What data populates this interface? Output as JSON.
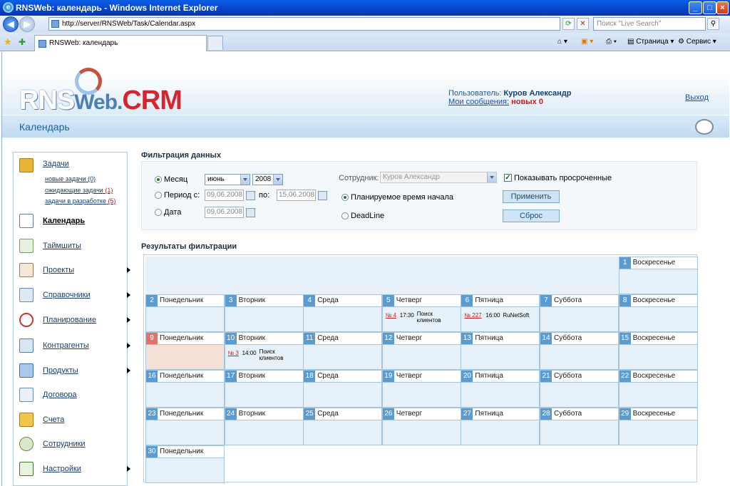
{
  "window": {
    "title": "RNSWeb: календарь - Windows Internet Explorer"
  },
  "browser": {
    "url": "http://server/RNSWeb/Task/Calendar.aspx",
    "search_placeholder": "Поиск \"Live Search\"",
    "tab_title": "RNSWeb: календарь",
    "toolbar": {
      "page": "Страница",
      "tools": "Сервис"
    }
  },
  "header": {
    "logo": {
      "rns": "RNS",
      "web": "Web.",
      "crm": "CRM"
    },
    "user_label": "Пользователь:",
    "user_name": "Куров Александр",
    "messages_link": "Мои сообщения:",
    "messages_new": "новых",
    "messages_count": "0",
    "logout": "Выход",
    "page_title": "Календарь"
  },
  "sidebar": {
    "tasks": {
      "label": "Задачи",
      "sub": [
        {
          "label": "новые задачи",
          "count": "(0)"
        },
        {
          "label": "ожидающие задачи",
          "count": "(1)"
        },
        {
          "label": "задачи в разработке",
          "count": "(5)"
        }
      ]
    },
    "items": [
      {
        "label": "Календарь"
      },
      {
        "label": "Таймшиты"
      },
      {
        "label": "Проекты"
      },
      {
        "label": "Справочники"
      },
      {
        "label": "Планирование"
      },
      {
        "label": "Контрагенты"
      },
      {
        "label": "Продукты"
      },
      {
        "label": "Договора"
      },
      {
        "label": "Счета"
      },
      {
        "label": "Сотрудники"
      },
      {
        "label": "Настройки"
      }
    ]
  },
  "filter": {
    "title": "Фильтрация данных",
    "month_label": "Месяц",
    "month_value": "июнь",
    "year_value": "2008",
    "period_label": "Период с:",
    "period_from": "09.06.2008",
    "period_to_label": "по:",
    "period_to": "15.06.2008",
    "date_label": "Дата",
    "date_value": "09.06.2008",
    "employee_label": "Сотрудник:",
    "employee_value": "Куров Александр",
    "show_overdue": "Показывать просроченные",
    "planned_start": "Планируемое время начала",
    "deadline": "DeadLine",
    "apply": "Применить",
    "reset": "Сброс"
  },
  "results": {
    "title": "Результаты фильтрации"
  },
  "calendar": {
    "days": [
      {
        "num": "1",
        "name": "Воскресенье"
      },
      {
        "num": "2",
        "name": "Понедельник"
      },
      {
        "num": "3",
        "name": "Вторник"
      },
      {
        "num": "4",
        "name": "Среда"
      },
      {
        "num": "5",
        "name": "Четверг",
        "event": {
          "ref": "№ 4",
          "time": "17:30",
          "desc": "Поиск клиентов"
        }
      },
      {
        "num": "6",
        "name": "Пятница",
        "event": {
          "ref": "№ 227",
          "time": "16:00",
          "desc": "RuNetSoft"
        }
      },
      {
        "num": "7",
        "name": "Суббота"
      },
      {
        "num": "8",
        "name": "Воскресенье"
      },
      {
        "num": "9",
        "name": "Понедельник",
        "today": true
      },
      {
        "num": "10",
        "name": "Вторник",
        "event": {
          "ref": "№ 3",
          "time": "14:00",
          "desc": "Поиск клиентов"
        }
      },
      {
        "num": "11",
        "name": "Среда"
      },
      {
        "num": "12",
        "name": "Четверг"
      },
      {
        "num": "13",
        "name": "Пятница"
      },
      {
        "num": "14",
        "name": "Суббота"
      },
      {
        "num": "15",
        "name": "Воскресенье"
      },
      {
        "num": "16",
        "name": "Понедельник"
      },
      {
        "num": "17",
        "name": "Вторник"
      },
      {
        "num": "18",
        "name": "Среда"
      },
      {
        "num": "19",
        "name": "Четверг"
      },
      {
        "num": "20",
        "name": "Пятница"
      },
      {
        "num": "21",
        "name": "Суббота"
      },
      {
        "num": "22",
        "name": "Воскресенье"
      },
      {
        "num": "23",
        "name": "Понедельник"
      },
      {
        "num": "24",
        "name": "Вторник"
      },
      {
        "num": "25",
        "name": "Среда"
      },
      {
        "num": "26",
        "name": "Четверг"
      },
      {
        "num": "27",
        "name": "Пятница"
      },
      {
        "num": "28",
        "name": "Суббота"
      },
      {
        "num": "29",
        "name": "Воскресенье"
      },
      {
        "num": "30",
        "name": "Понедельник"
      }
    ]
  }
}
